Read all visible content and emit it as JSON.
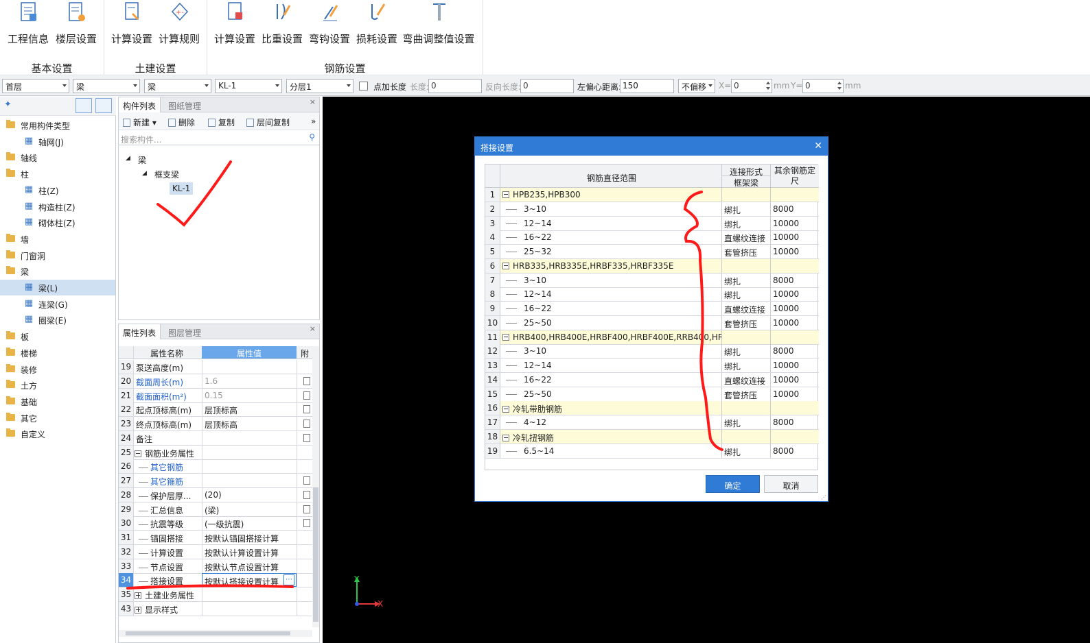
{
  "ribbon": {
    "groups": [
      {
        "title": "基本设置",
        "buttons": [
          "工程信息",
          "楼层设置"
        ]
      },
      {
        "title": "土建设置",
        "buttons": [
          "计算设置",
          "计算规则"
        ]
      },
      {
        "title": "钢筋设置",
        "buttons": [
          "计算设置",
          "比重设置",
          "弯钩设置",
          "损耗设置",
          "弯曲调整值设置"
        ]
      }
    ]
  },
  "toolbar": {
    "floor": "首层",
    "type1": "梁",
    "type2": "梁",
    "component": "KL-1",
    "layer": "分层1",
    "point_length_label": "点加长度",
    "length_label": "长度:",
    "length_value": "0",
    "reverse_length_label": "反向长度:",
    "reverse_length_value": "0",
    "left_offset_label": "左偏心距离:",
    "left_offset_value": "150",
    "offset_mode": "不偏移",
    "x_label": "X=",
    "x_value": "0",
    "x_unit": "mm",
    "y_label": "Y=",
    "y_value": "0",
    "y_unit": "mm"
  },
  "nav": {
    "items": [
      {
        "label": "常用构件类型",
        "kind": "folder"
      },
      {
        "label": "轴网(J)",
        "kind": "child"
      },
      {
        "label": "轴线",
        "kind": "folder"
      },
      {
        "label": "柱",
        "kind": "folder"
      },
      {
        "label": "柱(Z)",
        "kind": "child"
      },
      {
        "label": "构造柱(Z)",
        "kind": "child"
      },
      {
        "label": "砌体柱(Z)",
        "kind": "child"
      },
      {
        "label": "墙",
        "kind": "folder"
      },
      {
        "label": "门窗洞",
        "kind": "folder"
      },
      {
        "label": "梁",
        "kind": "folder"
      },
      {
        "label": "梁(L)",
        "kind": "child"
      },
      {
        "label": "连梁(G)",
        "kind": "child"
      },
      {
        "label": "圈梁(E)",
        "kind": "child"
      },
      {
        "label": "板",
        "kind": "folder"
      },
      {
        "label": "楼梯",
        "kind": "folder"
      },
      {
        "label": "装修",
        "kind": "folder"
      },
      {
        "label": "土方",
        "kind": "folder"
      },
      {
        "label": "基础",
        "kind": "folder"
      },
      {
        "label": "其它",
        "kind": "folder"
      },
      {
        "label": "自定义",
        "kind": "folder"
      }
    ]
  },
  "components": {
    "tabs": [
      "构件列表",
      "图纸管理"
    ],
    "tools": [
      "新建",
      "删除",
      "复制",
      "层间复制"
    ],
    "search_placeholder": "搜索构件...",
    "tree": {
      "root": "梁",
      "group": "框支梁",
      "item": "KL-1"
    }
  },
  "properties": {
    "tabs": [
      "属性列表",
      "图层管理"
    ],
    "headers": {
      "name": "属性名称",
      "value": "属性值",
      "extra": "附"
    },
    "rows": [
      {
        "n": "19",
        "name": "泵送高度(m)",
        "value": "",
        "chk": false,
        "blue": false,
        "gray": false,
        "indent": 0
      },
      {
        "n": "20",
        "name": "截面周长(m)",
        "value": "1.6",
        "chk": true,
        "blue": true,
        "gray": true,
        "indent": 0
      },
      {
        "n": "21",
        "name": "截面面积(m²)",
        "value": "0.15",
        "chk": true,
        "blue": true,
        "gray": true,
        "indent": 0
      },
      {
        "n": "22",
        "name": "起点顶标高(m)",
        "value": "层顶标高",
        "chk": true,
        "blue": false,
        "gray": false,
        "indent": 0
      },
      {
        "n": "23",
        "name": "终点顶标高(m)",
        "value": "层顶标高",
        "chk": true,
        "blue": false,
        "gray": false,
        "indent": 0
      },
      {
        "n": "24",
        "name": "备注",
        "value": "",
        "chk": true,
        "blue": false,
        "gray": false,
        "indent": 0
      },
      {
        "n": "25",
        "name": "钢筋业务属性",
        "value": "",
        "chk": false,
        "blue": false,
        "gray": false,
        "indent": 0,
        "exp": "minus"
      },
      {
        "n": "26",
        "name": "其它钢筋",
        "value": "",
        "chk": false,
        "blue": true,
        "gray": false,
        "indent": 1
      },
      {
        "n": "27",
        "name": "其它箍筋",
        "value": "",
        "chk": true,
        "blue": true,
        "gray": false,
        "indent": 1
      },
      {
        "n": "28",
        "name": "保护层厚...",
        "value": "(20)",
        "chk": true,
        "blue": false,
        "gray": false,
        "indent": 1
      },
      {
        "n": "29",
        "name": "汇总信息",
        "value": "(梁)",
        "chk": true,
        "blue": false,
        "gray": false,
        "indent": 1
      },
      {
        "n": "30",
        "name": "抗震等级",
        "value": "(一级抗震)",
        "chk": true,
        "blue": false,
        "gray": false,
        "indent": 1
      },
      {
        "n": "31",
        "name": "锚固搭接",
        "value": "按默认锚固搭接计算",
        "chk": false,
        "blue": false,
        "gray": false,
        "indent": 1
      },
      {
        "n": "32",
        "name": "计算设置",
        "value": "按默认计算设置计算",
        "chk": false,
        "blue": false,
        "gray": false,
        "indent": 1
      },
      {
        "n": "33",
        "name": "节点设置",
        "value": "按默认节点设置计算",
        "chk": false,
        "blue": false,
        "gray": false,
        "indent": 1
      },
      {
        "n": "34",
        "name": "搭接设置",
        "value": "按默认搭接设置计算",
        "chk": false,
        "blue": false,
        "gray": false,
        "indent": 1,
        "selected": true
      },
      {
        "n": "35",
        "name": "土建业务属性",
        "value": "",
        "chk": false,
        "blue": false,
        "gray": false,
        "indent": 0,
        "exp": "plus"
      },
      {
        "n": "43",
        "name": "显示样式",
        "value": "",
        "chk": false,
        "blue": false,
        "gray": false,
        "indent": 0,
        "exp": "plus"
      }
    ]
  },
  "axis": {
    "y": "Y",
    "x": "X"
  },
  "dialog": {
    "title": "搭接设置",
    "headers": {
      "range": "钢筋直径范围",
      "conn": "连接形式",
      "conn_sub": "框架梁",
      "len": "其余钢筋定尺"
    },
    "rows": [
      {
        "n": "1",
        "range": "HPB235,HPB300",
        "conn": "",
        "len": "",
        "group": true
      },
      {
        "n": "2",
        "range": "3~10",
        "conn": "绑扎",
        "len": "8000",
        "group": false
      },
      {
        "n": "3",
        "range": "12~14",
        "conn": "绑扎",
        "len": "10000",
        "group": false
      },
      {
        "n": "4",
        "range": "16~22",
        "conn": "直螺纹连接",
        "len": "10000",
        "group": false
      },
      {
        "n": "5",
        "range": "25~32",
        "conn": "套管挤压",
        "len": "10000",
        "group": false
      },
      {
        "n": "6",
        "range": "HRB335,HRB335E,HRBF335,HRBF335E",
        "conn": "",
        "len": "",
        "group": true
      },
      {
        "n": "7",
        "range": "3~10",
        "conn": "绑扎",
        "len": "8000",
        "group": false
      },
      {
        "n": "8",
        "range": "12~14",
        "conn": "绑扎",
        "len": "10000",
        "group": false
      },
      {
        "n": "9",
        "range": "16~22",
        "conn": "直螺纹连接",
        "len": "10000",
        "group": false
      },
      {
        "n": "10",
        "range": "25~50",
        "conn": "套管挤压",
        "len": "10000",
        "group": false
      },
      {
        "n": "11",
        "range": "HRB400,HRB400E,HRBF400,HRBF400E,RRB400,HR...",
        "conn": "",
        "len": "",
        "group": true
      },
      {
        "n": "12",
        "range": "3~10",
        "conn": "绑扎",
        "len": "8000",
        "group": false
      },
      {
        "n": "13",
        "range": "12~14",
        "conn": "绑扎",
        "len": "10000",
        "group": false
      },
      {
        "n": "14",
        "range": "16~22",
        "conn": "直螺纹连接",
        "len": "10000",
        "group": false
      },
      {
        "n": "15",
        "range": "25~50",
        "conn": "套管挤压",
        "len": "10000",
        "group": false
      },
      {
        "n": "16",
        "range": "冷轧带肋钢筋",
        "conn": "",
        "len": "",
        "group": true
      },
      {
        "n": "17",
        "range": "4~12",
        "conn": "绑扎",
        "len": "8000",
        "group": false
      },
      {
        "n": "18",
        "range": "冷轧扭钢筋",
        "conn": "",
        "len": "",
        "group": true
      },
      {
        "n": "19",
        "range": "6.5~14",
        "conn": "绑扎",
        "len": "8000",
        "group": false
      }
    ],
    "ok": "确定",
    "cancel": "取消"
  },
  "colors": {
    "accent": "#2f7bd6",
    "annotation": "#ff1a1a",
    "canvas": "#000000",
    "group_row": "#fdfbd8"
  }
}
